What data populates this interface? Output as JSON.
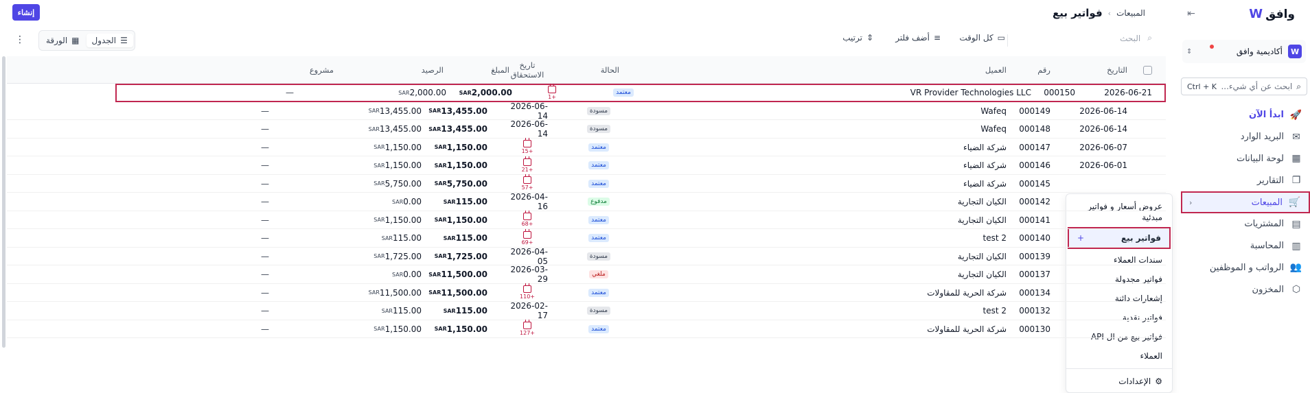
{
  "header": {
    "create_label": "إنشاء",
    "breadcrumb_parent": "المبيعات",
    "breadcrumb_sep": "›",
    "title": "فواتير بيع"
  },
  "sidebar": {
    "brand_name": "وافق",
    "brand_mark": "W",
    "org_name": "أكاديمية وافق",
    "org_logo": "W",
    "search_placeholder": "ابحث عن أي شيء...",
    "search_shortcut": "Ctrl + K",
    "items": [
      {
        "label": "ابدأ الآن",
        "icon": "rocket-icon",
        "glyph": "🚀"
      },
      {
        "label": "البريد الوارد",
        "icon": "inbox-icon",
        "glyph": "✉"
      },
      {
        "label": "لوحة البيانات",
        "icon": "dashboard-icon",
        "glyph": "▦"
      },
      {
        "label": "التقارير",
        "icon": "reports-icon",
        "glyph": "❐"
      },
      {
        "label": "المبيعات",
        "icon": "cart-icon",
        "glyph": "🛒"
      },
      {
        "label": "المشتريات",
        "icon": "receipt-icon",
        "glyph": "▤"
      },
      {
        "label": "المحاسبة",
        "icon": "ledger-icon",
        "glyph": "▥"
      },
      {
        "label": "الرواتب و الموظفين",
        "icon": "users-icon",
        "glyph": "👥"
      },
      {
        "label": "المخزون",
        "icon": "box-icon",
        "glyph": "⬡"
      }
    ]
  },
  "flyout": {
    "items": [
      "عروض أسعار و فواتير مبدئية",
      "فواتير بيع",
      "سندات العملاء",
      "فواتير مجدولة",
      "إشعارات دائنة",
      "فواتير نقدية",
      "فواتير بيع من ال API",
      "العملاء"
    ],
    "add_label": "+",
    "settings_label": "الإعدادات"
  },
  "toolbar": {
    "search_placeholder": "البحث",
    "all_time": "كل الوقت",
    "add_filter": "أضف فلتر",
    "sort": "ترتيب",
    "view_table": "الجدول",
    "view_sheet": "الورقة",
    "more": "⋮"
  },
  "table": {
    "columns": {
      "date": "التاريخ",
      "number": "رقم",
      "customer": "العميل",
      "status": "الحالة",
      "due_date": "تاريخ الاستحقاق",
      "amount": "المبلغ",
      "balance": "الرصيد",
      "project": "مشروع"
    },
    "currency": "SAR",
    "rows": [
      {
        "date": "2026-06-21",
        "number": "000150",
        "customer": "VR Provider Technologies LLC",
        "status": "معتمد",
        "status_kind": "approved",
        "due": "",
        "due_badge": "+1",
        "amount": "2,000.00",
        "balance": "2,000.00",
        "project": "—"
      },
      {
        "date": "2026-06-14",
        "number": "000149",
        "customer": "Wafeq",
        "status": "مسودة",
        "status_kind": "draft",
        "due": "2026-06-14",
        "due_badge": "",
        "amount": "13,455.00",
        "balance": "13,455.00",
        "project": "—"
      },
      {
        "date": "2026-06-14",
        "number": "000148",
        "customer": "Wafeq",
        "status": "مسودة",
        "status_kind": "draft",
        "due": "2026-06-14",
        "due_badge": "",
        "amount": "13,455.00",
        "balance": "13,455.00",
        "project": "—"
      },
      {
        "date": "2026-06-07",
        "number": "000147",
        "customer": "شركة الضياء",
        "status": "معتمد",
        "status_kind": "approved",
        "due": "",
        "due_badge": "+15",
        "amount": "1,150.00",
        "balance": "1,150.00",
        "project": "—"
      },
      {
        "date": "2026-06-01",
        "number": "000146",
        "customer": "شركة الضياء",
        "status": "معتمد",
        "status_kind": "approved",
        "due": "",
        "due_badge": "+21",
        "amount": "1,150.00",
        "balance": "1,150.00",
        "project": "—"
      },
      {
        "date": "",
        "number": "000145",
        "customer": "شركة الضياء",
        "status": "معتمد",
        "status_kind": "approved",
        "due": "",
        "due_badge": "+57",
        "amount": "5,750.00",
        "balance": "5,750.00",
        "project": "—"
      },
      {
        "date": "",
        "number": "000142",
        "customer": "الكيان التجارية",
        "status": "مدفوع",
        "status_kind": "paid",
        "due": "2026-04-16",
        "due_badge": "",
        "amount": "115.00",
        "balance": "0.00",
        "project": "—"
      },
      {
        "date": "",
        "number": "000141",
        "customer": "الكيان التجارية",
        "status": "معتمد",
        "status_kind": "approved",
        "due": "",
        "due_badge": "+68",
        "amount": "1,150.00",
        "balance": "1,150.00",
        "project": "—"
      },
      {
        "date": "",
        "number": "000140",
        "customer": "test 2",
        "status": "معتمد",
        "status_kind": "approved",
        "due": "",
        "due_badge": "+69",
        "amount": "115.00",
        "balance": "115.00",
        "project": "—"
      },
      {
        "date": "",
        "number": "000139",
        "customer": "الكيان التجارية",
        "status": "مسودة",
        "status_kind": "draft",
        "due": "2026-04-05",
        "due_badge": "",
        "amount": "1,725.00",
        "balance": "1,725.00",
        "project": "—"
      },
      {
        "date": "",
        "number": "000137",
        "customer": "الكيان التجارية",
        "status": "ملغي",
        "status_kind": "cancelled",
        "due": "2026-03-29",
        "due_badge": "",
        "amount": "11,500.00",
        "balance": "0.00",
        "project": "—"
      },
      {
        "date": "",
        "number": "000134",
        "customer": "شركة الحرية للمقاولات",
        "status": "معتمد",
        "status_kind": "approved",
        "due": "",
        "due_badge": "+110",
        "amount": "11,500.00",
        "balance": "11,500.00",
        "project": "—"
      },
      {
        "date": "",
        "number": "000132",
        "customer": "test 2",
        "status": "مسودة",
        "status_kind": "draft",
        "due": "2026-02-17",
        "due_badge": "",
        "amount": "115.00",
        "balance": "115.00",
        "project": "—"
      },
      {
        "date": "",
        "number": "000130",
        "customer": "شركة الحرية للمقاولات",
        "status": "معتمد",
        "status_kind": "approved",
        "due": "",
        "due_badge": "+127",
        "amount": "1,150.00",
        "balance": "1,150.00",
        "project": "—"
      }
    ]
  },
  "colors": {
    "accent": "#4f46e5",
    "highlight_outline": "#c0264f",
    "overdue": "#be123c"
  }
}
